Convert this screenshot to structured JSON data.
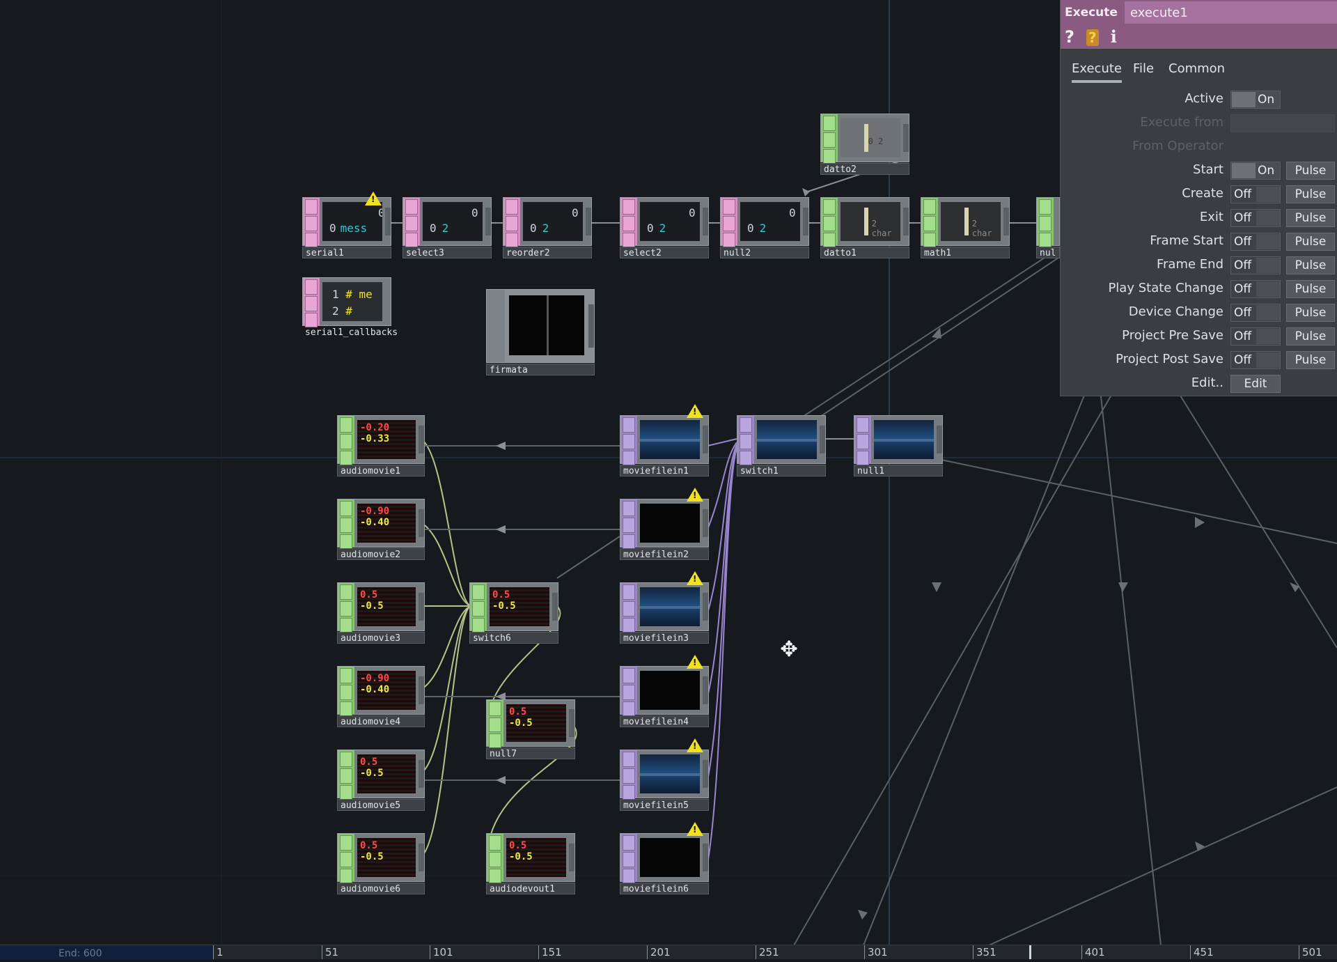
{
  "network": {
    "chop_nodes": [
      {
        "name": "serial1",
        "line1": "0",
        "line2_num": "0",
        "line2_text": "mess"
      },
      {
        "name": "select3",
        "line1": "0",
        "line2_num": "0",
        "line2_text": "2"
      },
      {
        "name": "reorder2",
        "line1": "0",
        "line2_num": "0",
        "line2_text": "2"
      },
      {
        "name": "select2",
        "line1": "0",
        "line2_num": "0",
        "line2_text": "2"
      },
      {
        "name": "null2",
        "line1": "0",
        "line2_num": "0",
        "line2_text": "2"
      }
    ],
    "datto2": {
      "name": "datto2",
      "value": "0 2"
    },
    "datto1": {
      "name": "datto1",
      "value": "2 char"
    },
    "math1": {
      "name": "math1",
      "value": "2 char"
    },
    "nul_partial": {
      "name": "nul"
    },
    "callbacks": {
      "name": "serial1_callbacks",
      "row1_num": "1",
      "row1_text": "# me",
      "row2_num": "2",
      "row2_text": "#"
    },
    "firmata": {
      "name": "firmata"
    },
    "audio_nodes": [
      {
        "name": "audiomovie1",
        "top": "-0.20",
        "bottom": "-0.33"
      },
      {
        "name": "audiomovie2",
        "top": "-0.90",
        "bottom": "-0.40"
      },
      {
        "name": "audiomovie3",
        "top": "0.5",
        "bottom": "-0.5"
      },
      {
        "name": "audiomovie4",
        "top": "-0.90",
        "bottom": "-0.40"
      },
      {
        "name": "audiomovie5",
        "top": "0.5",
        "bottom": "-0.5"
      },
      {
        "name": "audiomovie6",
        "top": "0.5",
        "bottom": "-0.5"
      }
    ],
    "switch6": {
      "name": "switch6",
      "top": "0.5",
      "bottom": "-0.5"
    },
    "null7": {
      "name": "null7",
      "top": "0.5",
      "bottom": "-0.5"
    },
    "audiodevout1": {
      "name": "audiodevout1",
      "top": "0.5",
      "bottom": "-0.5"
    },
    "movie_nodes": [
      {
        "name": "moviefilein1"
      },
      {
        "name": "moviefilein2"
      },
      {
        "name": "moviefilein3"
      },
      {
        "name": "moviefilein4"
      },
      {
        "name": "moviefilein5"
      },
      {
        "name": "moviefilein6"
      }
    ],
    "switch1": {
      "name": "switch1"
    },
    "null1": {
      "name": "null1"
    }
  },
  "timeline": {
    "range_label": "End:   600",
    "ticks": [
      "1",
      "51",
      "101",
      "151",
      "201",
      "251",
      "301",
      "351",
      "401",
      "451",
      "501"
    ],
    "playhead_frame": 355
  },
  "panel": {
    "op_type": "Execute",
    "op_name": "execute1",
    "icons": [
      "help-icon",
      "python-help-icon",
      "info-icon"
    ],
    "icon_glyphs": {
      "help": "?",
      "python": "?",
      "info": "i"
    },
    "tabs": [
      "Execute",
      "File",
      "Common"
    ],
    "active_tab": "Execute",
    "params": {
      "active": {
        "label": "Active",
        "state": "On"
      },
      "execute_from": {
        "label": "Execute from"
      },
      "from_operator": {
        "label": "From Operator"
      },
      "start": {
        "label": "Start",
        "state": "On",
        "pulse": "Pulse"
      },
      "create": {
        "label": "Create",
        "state": "Off",
        "pulse": "Pulse"
      },
      "exit": {
        "label": "Exit",
        "state": "Off",
        "pulse": "Pulse"
      },
      "frame_start": {
        "label": "Frame Start",
        "state": "Off",
        "pulse": "Pulse"
      },
      "frame_end": {
        "label": "Frame End",
        "state": "Off",
        "pulse": "Pulse"
      },
      "play_state_change": {
        "label": "Play State Change",
        "state": "Off",
        "pulse": "Pulse"
      },
      "device_change": {
        "label": "Device Change",
        "state": "Off",
        "pulse": "Pulse"
      },
      "project_pre_save": {
        "label": "Project Pre Save",
        "state": "Off",
        "pulse": "Pulse"
      },
      "project_post_save": {
        "label": "Project Post Save",
        "state": "Off",
        "pulse": "Pulse"
      },
      "edit": {
        "label": "Edit..",
        "button": "Edit"
      }
    }
  },
  "colors": {
    "chop": "#d78bc2",
    "dat": "#86c46e",
    "top": "#9c86c8",
    "warning": "#f2e21e",
    "panel_header": "#8a5a80"
  }
}
